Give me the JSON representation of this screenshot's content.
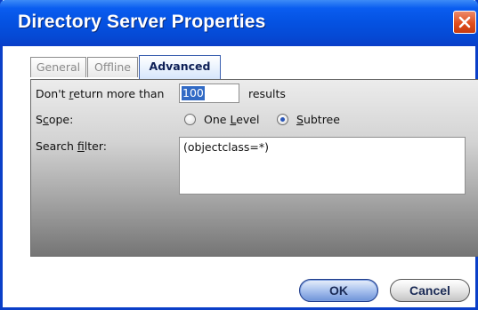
{
  "window": {
    "title": "Directory Server Properties"
  },
  "tabs": [
    {
      "label": "General",
      "active": false
    },
    {
      "label": "Offline",
      "active": false
    },
    {
      "label": "Advanced",
      "active": true
    }
  ],
  "advanced": {
    "limit_label_pre": "Don't ",
    "limit_label_mnemonic": "r",
    "limit_label_post": "eturn more than",
    "limit_value": "100",
    "limit_suffix": "results",
    "scope_label_pre": "S",
    "scope_label_mnemonic": "c",
    "scope_label_post": "ope:",
    "scope_options": [
      {
        "pre": "One ",
        "mnemonic": "L",
        "post": "evel",
        "selected": false
      },
      {
        "pre": "",
        "mnemonic": "S",
        "post": "ubtree",
        "selected": true
      }
    ],
    "filter_label_pre": "Search ",
    "filter_label_mnemonic": "f",
    "filter_label_post": "ilter:",
    "filter_value": "(objectclass=*)"
  },
  "buttons": {
    "ok_label": "OK",
    "cancel_label": "Cancel"
  },
  "colors": {
    "titlebar": "#0553e3",
    "close_button": "#e04f1e",
    "selection": "#316ac5"
  }
}
